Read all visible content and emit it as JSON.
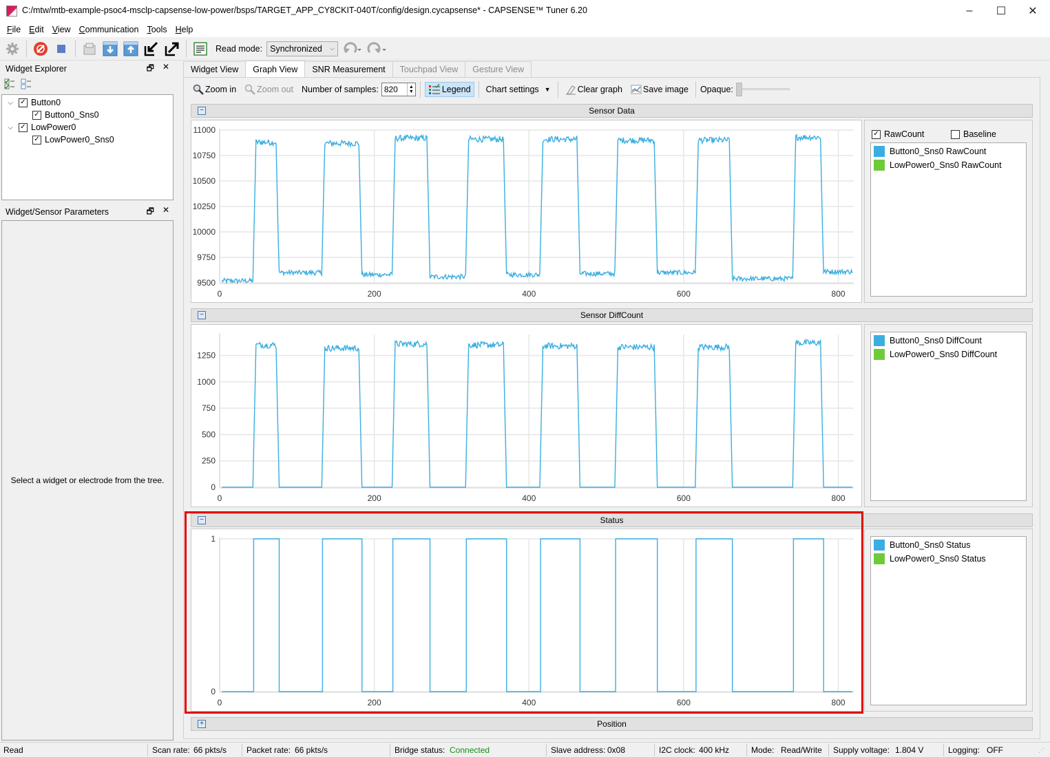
{
  "window": {
    "title": "C:/mtw/mtb-example-psoc4-msclp-capsense-low-power/bsps/TARGET_APP_CY8CKIT-040T/config/design.cycapsense* - CAPSENSE™ Tuner 6.20",
    "minimize": "–",
    "maximize": "☐",
    "close": "✕"
  },
  "menu": [
    {
      "label": "File",
      "accel": "F",
      "rest": "ile"
    },
    {
      "label": "Edit",
      "accel": "E",
      "rest": "dit"
    },
    {
      "label": "View",
      "accel": "V",
      "rest": "iew"
    },
    {
      "label": "Communication",
      "accel": "C",
      "rest": "ommunication"
    },
    {
      "label": "Tools",
      "accel": "T",
      "rest": "ools"
    },
    {
      "label": "Help",
      "accel": "H",
      "rest": "elp"
    }
  ],
  "toolbar": {
    "read_mode_label": "Read mode:",
    "read_mode_value": "Synchronized",
    "icons": [
      "settings-icon",
      "disconnect-icon",
      "stop-icon",
      "open-icon",
      "read-from-device-icon",
      "write-to-device-icon",
      "import-icon",
      "export-icon",
      "log-icon",
      "undo-icon",
      "redo-icon"
    ]
  },
  "widget_explorer": {
    "title": "Widget Explorer",
    "tree": [
      {
        "label": "Button0",
        "checked": true,
        "expanded": true,
        "children": [
          {
            "label": "Button0_Sns0",
            "checked": true
          }
        ]
      },
      {
        "label": "LowPower0",
        "checked": true,
        "expanded": true,
        "children": [
          {
            "label": "LowPower0_Sns0",
            "checked": true
          }
        ]
      }
    ]
  },
  "params_panel": {
    "title": "Widget/Sensor Parameters",
    "placeholder": "Select a widget or electrode from the tree."
  },
  "tabs": [
    {
      "label": "Widget View",
      "state": "normal"
    },
    {
      "label": "Graph View",
      "state": "active"
    },
    {
      "label": "SNR Measurement",
      "state": "normal"
    },
    {
      "label": "Touchpad View",
      "state": "disabled"
    },
    {
      "label": "Gesture View",
      "state": "disabled"
    }
  ],
  "graph_toolbar": {
    "zoom_in": "Zoom in",
    "zoom_out": "Zoom out",
    "samples_label": "Number of samples:",
    "samples_value": "820",
    "legend": "Legend",
    "chart_settings": "Chart settings",
    "clear_graph": "Clear graph",
    "save_image": "Save image",
    "opaque_label": "Opaque:",
    "opaque_value": 0
  },
  "sections": {
    "sensor_data": "Sensor Data",
    "diffcount": "Sensor DiffCount",
    "status": "Status",
    "position": "Position"
  },
  "legend": {
    "rawcount_checkbox": "RawCount",
    "rawcount_checked": true,
    "baseline_checkbox": "Baseline",
    "baseline_checked": false,
    "sensor_data": [
      {
        "label": "Button0_Sns0 RawCount",
        "color": "#3aaee0"
      },
      {
        "label": "LowPower0_Sns0 RawCount",
        "color": "#6fca3a"
      }
    ],
    "diffcount": [
      {
        "label": "Button0_Sns0 DiffCount",
        "color": "#3aaee0"
      },
      {
        "label": "LowPower0_Sns0 DiffCount",
        "color": "#6fca3a"
      }
    ],
    "status": [
      {
        "label": "Button0_Sns0 Status",
        "color": "#3aaee0"
      },
      {
        "label": "LowPower0_Sns0 Status",
        "color": "#6fca3a"
      }
    ]
  },
  "chart_data": [
    {
      "type": "line",
      "title": "Sensor Data",
      "series": [
        {
          "name": "Button0_Sns0 RawCount",
          "color": "#3aaee0"
        }
      ],
      "xlim": [
        0,
        820
      ],
      "ylim": [
        9500,
        11000
      ],
      "xticks": [
        "0",
        "200",
        "400",
        "600",
        "800"
      ],
      "yticks": [
        "9500",
        "9750",
        "10000",
        "10250",
        "10500",
        "10750",
        "11000"
      ],
      "grid": true,
      "pulses": [
        [
          44,
          76
        ],
        [
          133,
          183
        ],
        [
          224,
          271
        ],
        [
          319,
          370
        ],
        [
          415,
          465
        ],
        [
          512,
          565
        ],
        [
          616,
          662
        ],
        [
          742,
          780
        ]
      ],
      "high_level": [
        10880,
        10870,
        10920,
        10910,
        10910,
        10900,
        10900,
        10930
      ],
      "low_level": [
        9520,
        9600,
        9580,
        9560,
        9580,
        9590,
        9600,
        9540,
        9610
      ],
      "noise": 30
    },
    {
      "type": "line",
      "title": "Sensor DiffCount",
      "series": [
        {
          "name": "Button0_Sns0 DiffCount",
          "color": "#3aaee0"
        }
      ],
      "xlim": [
        0,
        820
      ],
      "ylim": [
        0,
        1450
      ],
      "xticks": [
        "0",
        "200",
        "400",
        "600",
        "800"
      ],
      "yticks": [
        "0",
        "250",
        "500",
        "750",
        "1000",
        "1250"
      ],
      "grid": true,
      "pulses": [
        [
          44,
          76
        ],
        [
          133,
          183
        ],
        [
          224,
          271
        ],
        [
          319,
          370
        ],
        [
          415,
          465
        ],
        [
          512,
          565
        ],
        [
          616,
          662
        ],
        [
          742,
          780
        ]
      ],
      "high_level": [
        1350,
        1320,
        1360,
        1350,
        1340,
        1330,
        1330,
        1370
      ],
      "low_level": [
        0,
        0,
        0,
        0,
        0,
        0,
        0,
        0,
        0
      ],
      "noise": 30
    },
    {
      "type": "line",
      "title": "Status",
      "series": [
        {
          "name": "Button0_Sns0 Status",
          "color": "#3aaee0"
        }
      ],
      "xlim": [
        0,
        820
      ],
      "ylim": [
        0,
        1
      ],
      "xticks": [
        "0",
        "200",
        "400",
        "600",
        "800"
      ],
      "yticks": [
        "0",
        "1"
      ],
      "grid": true,
      "pulses": [
        [
          44,
          76
        ],
        [
          133,
          183
        ],
        [
          224,
          271
        ],
        [
          319,
          370
        ],
        [
          415,
          465
        ],
        [
          512,
          565
        ],
        [
          616,
          662
        ],
        [
          742,
          780
        ]
      ],
      "high_level": [
        1,
        1,
        1,
        1,
        1,
        1,
        1,
        1
      ],
      "low_level": [
        0,
        0,
        0,
        0,
        0,
        0,
        0,
        0,
        0
      ],
      "noise": 0
    }
  ],
  "statusbar": {
    "state": "Read",
    "scan_rate_label": "Scan rate:",
    "scan_rate": "66 pkts/s",
    "packet_rate_label": "Packet rate:",
    "packet_rate": "66 pkts/s",
    "bridge_label": "Bridge status:",
    "bridge_value": "Connected",
    "bridge_color": "#1a8a1a",
    "slave_label": "Slave address:",
    "slave_value": "0x08",
    "i2c_label": "I2C clock:",
    "i2c_value": "400 kHz",
    "mode_label": "Mode:",
    "mode_value": "Read/Write",
    "supply_label": "Supply voltage:",
    "supply_value": "1.804 V",
    "logging_label": "Logging:",
    "logging_value": "OFF"
  }
}
